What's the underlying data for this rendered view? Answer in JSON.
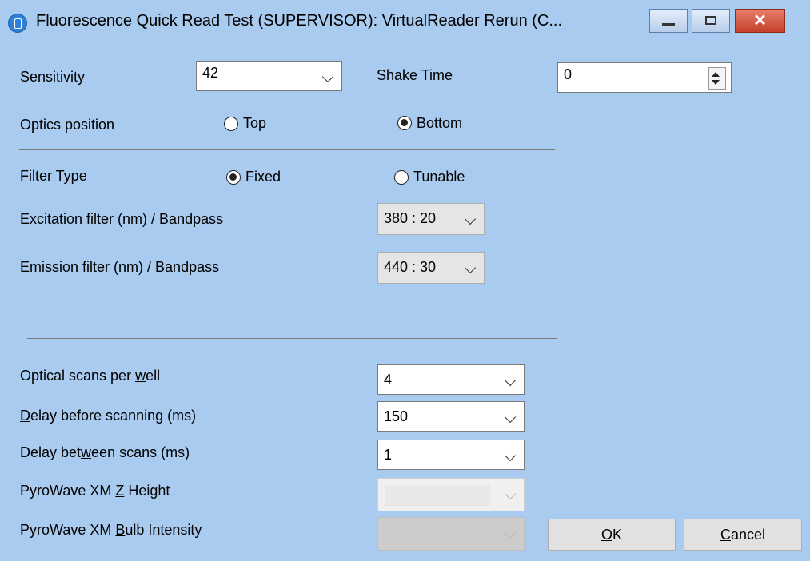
{
  "window": {
    "title": "Fluorescence Quick Read Test (SUPERVISOR): VirtualReader Rerun (C...",
    "minimize_icon": "minimize-icon",
    "maximize_icon": "maximize-icon",
    "close_icon": "close-icon",
    "close_glyph": "✕"
  },
  "form": {
    "sensitivity": {
      "label": "Sensitivity",
      "value": "42"
    },
    "shake_time": {
      "label": "Shake Time",
      "value": "0"
    },
    "optics_position": {
      "label": "Optics position",
      "options": [
        "Top",
        "Bottom"
      ],
      "selected": "Bottom"
    },
    "filter_type": {
      "label": "Filter Type",
      "options": [
        "Fixed",
        "Tunable"
      ],
      "selected": "Fixed"
    },
    "excitation": {
      "label_pre": "E",
      "label_u": "x",
      "label_post": "citation filter (nm) / Bandpass",
      "value": "380 : 20"
    },
    "emission": {
      "label_pre": "E",
      "label_u": "m",
      "label_post": "ission filter (nm) / Bandpass",
      "value": "440 : 30"
    },
    "optical_scans": {
      "label_pre": "Optical scans per ",
      "label_u": "w",
      "label_post": "ell",
      "value": "4"
    },
    "delay_before": {
      "label_pre": "",
      "label_u": "D",
      "label_post": "elay before scanning (ms)",
      "value": "150"
    },
    "delay_between": {
      "label_pre": "Delay bet",
      "label_u": "w",
      "label_post": "een scans (ms)",
      "value": "1"
    },
    "z_height": {
      "label_pre": "PyroWave XM ",
      "label_u": "Z",
      "label_post": " Height",
      "value": ""
    },
    "bulb_intensity": {
      "label_pre": "PyroWave XM ",
      "label_u": "B",
      "label_post": "ulb Intensity",
      "value": ""
    }
  },
  "buttons": {
    "ok": {
      "label_u": "O",
      "label_post": "K"
    },
    "cancel": {
      "label_u": "C",
      "label_post": "ancel"
    }
  }
}
